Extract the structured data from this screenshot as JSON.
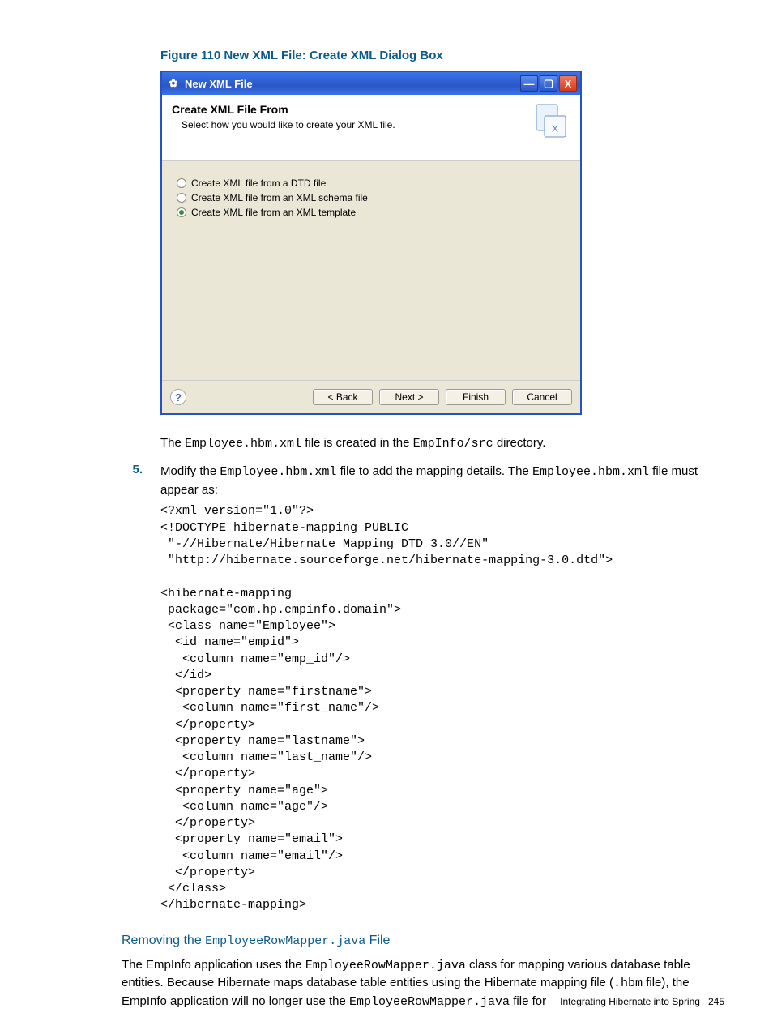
{
  "figure_caption": "Figure 110 New XML File: Create XML Dialog Box",
  "dialog": {
    "title": "New XML File",
    "header_title": "Create XML File From",
    "header_sub": "Select how you would like to create your XML file.",
    "options": {
      "o0": "Create XML file from a DTD file",
      "o1": "Create XML file from an XML schema file",
      "o2": "Create XML file from an XML template"
    },
    "selected": "o2",
    "buttons": {
      "back": "< Back",
      "next": "Next >",
      "finish": "Finish",
      "cancel": "Cancel"
    },
    "help_glyph": "?",
    "close_glyph": "X",
    "max_glyph": "▢",
    "min_glyph": "—",
    "title_icon_glyph": "✿"
  },
  "para1": {
    "pre": "The ",
    "code1": "Employee.hbm.xml",
    "mid": " file is created in the ",
    "code2": "EmpInfo/src",
    "post": " directory."
  },
  "step5": {
    "num": "5.",
    "pre": "Modify the ",
    "code1": "Employee.hbm.xml",
    "mid": " file to add the mapping details. The ",
    "code2": "Employee.hbm.xml",
    "post": " file must appear as:"
  },
  "code_block": "<?xml version=\"1.0\"?>\n<!DOCTYPE hibernate-mapping PUBLIC\n \"-//Hibernate/Hibernate Mapping DTD 3.0//EN\"\n \"http://hibernate.sourceforge.net/hibernate-mapping-3.0.dtd\">\n\n<hibernate-mapping\n package=\"com.hp.empinfo.domain\">\n <class name=\"Employee\">\n  <id name=\"empid\">\n   <column name=\"emp_id\"/>\n  </id>\n  <property name=\"firstname\">\n   <column name=\"first_name\"/>\n  </property>\n  <property name=\"lastname\">\n   <column name=\"last_name\"/>\n  </property>\n  <property name=\"age\">\n   <column name=\"age\"/>\n  </property>\n  <property name=\"email\">\n   <column name=\"email\"/>\n  </property>\n </class>\n</hibernate-mapping>",
  "subhead": {
    "pre": "Removing the ",
    "code": "EmployeeRowMapper.java",
    "post": " File"
  },
  "para2": {
    "l1a": "The EmpInfo application uses the ",
    "l1code": "EmployeeRowMapper.java",
    "l1b": " class for mapping various database table entities. Because Hibernate maps database table entities using the Hibernate mapping file (",
    "l2code": ".hbm",
    "l2a": " file), the EmpInfo application will no longer use the ",
    "l3code": "EmployeeRowMapper.java",
    "l3a": " file for"
  },
  "footer": {
    "text": "Integrating Hibernate into Spring",
    "page": "245"
  }
}
